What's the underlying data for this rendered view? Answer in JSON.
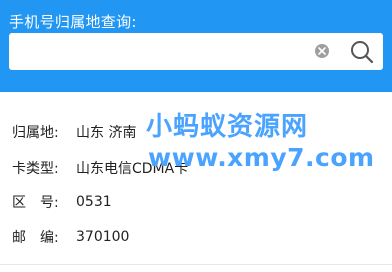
{
  "header": {
    "title": "手机号归属地查询:"
  },
  "search": {
    "value": "",
    "placeholder": "",
    "clear_icon": "clear-icon",
    "search_icon": "search-icon"
  },
  "result": {
    "rows": [
      {
        "label": "归属地:",
        "value": "山东 济南"
      },
      {
        "label": "卡类型:",
        "value": "山东电信CDMA卡"
      },
      {
        "label": "区　号:",
        "value": "0531"
      },
      {
        "label": "邮　编:",
        "value": "370100"
      }
    ]
  },
  "watermark": {
    "title": "小蚂蚁资源网",
    "url": "www.xmy7.com"
  },
  "colors": {
    "header_bg": "#2196f3",
    "watermark": "#4aa3ff"
  }
}
